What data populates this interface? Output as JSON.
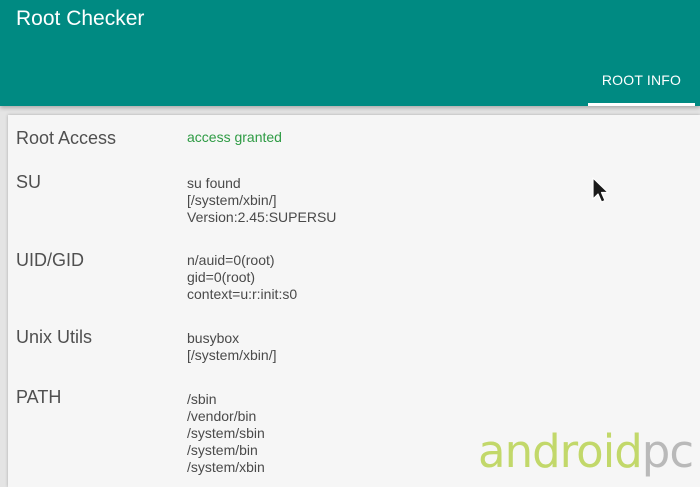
{
  "app": {
    "title": "Root Checker"
  },
  "tabs": [
    {
      "label": "ROOT INFO",
      "active": true
    }
  ],
  "colors": {
    "appbar": "#008a82",
    "granted": "#2e9b44"
  },
  "rows": [
    {
      "label": "Root Access",
      "values": [
        "access granted"
      ]
    },
    {
      "label": "SU",
      "values": [
        "su found",
        "[/system/xbin/]",
        "Version:2.45:SUPERSU"
      ]
    },
    {
      "label": "UID/GID",
      "values": [
        "n/auid=0(root)",
        "gid=0(root)",
        "context=u:r:init:s0"
      ]
    },
    {
      "label": "Unix Utils",
      "values": [
        "busybox",
        "[/system/xbin/]"
      ]
    },
    {
      "label": "PATH",
      "values": [
        "/sbin",
        "/vendor/bin",
        "/system/sbin",
        "/system/bin",
        "/system/xbin"
      ]
    }
  ],
  "icons": {
    "cursor": "mouse-pointer-icon"
  },
  "watermark": {
    "part1": "android",
    "part2": "pc"
  }
}
